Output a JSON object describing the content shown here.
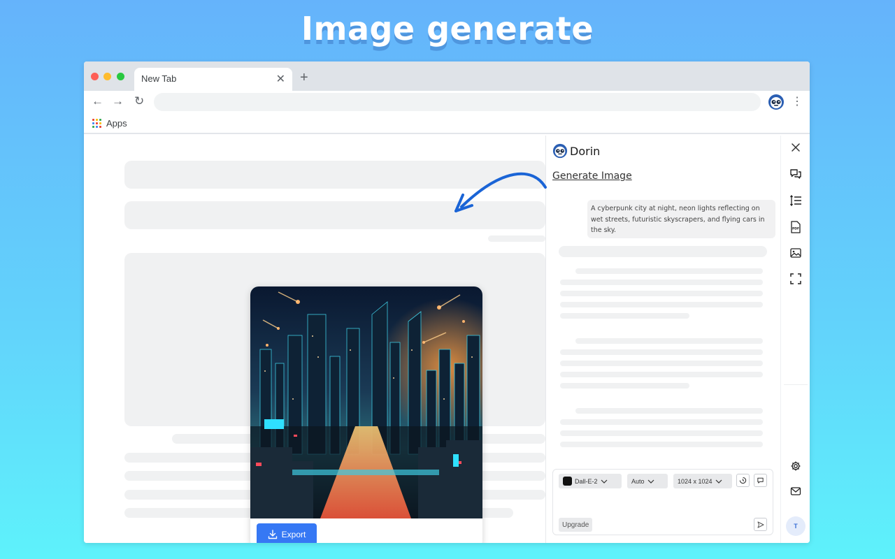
{
  "hero": {
    "title": "Image generate"
  },
  "browser": {
    "tab_title": "New Tab",
    "tab_close": "✕",
    "new_tab": "+",
    "back": "←",
    "forward": "→",
    "reload": "↻",
    "menu": "⋮",
    "bookmark_apps": "Apps",
    "apps_colors": [
      "#ea4335",
      "#fbbc05",
      "#34a853",
      "#4285f4",
      "#ea4335",
      "#fbbc05",
      "#34a853",
      "#4285f4",
      "#ea4335"
    ]
  },
  "image_card": {
    "export_label": "Export",
    "icons": {
      "export": "download-icon"
    }
  },
  "panel": {
    "brand_name": "Dorin",
    "heading": "Generate Image",
    "prompt_text": "A cyberpunk city at night, neon lights reflecting on wet streets, futuristic skyscrapers, and flying cars in the sky.",
    "compose": {
      "model": "Dall-E-2",
      "quality": "Auto",
      "size": "1024 x 1024",
      "upgrade_label": "Upgrade"
    }
  },
  "rail": {
    "icons": [
      "close-icon",
      "chat-icon",
      "line-spacing-icon",
      "pdf-icon",
      "image-icon",
      "screenshot-icon",
      "settings-icon",
      "mail-icon"
    ],
    "pdf_text": "PDF",
    "avatar_letter": "T"
  },
  "colors": {
    "background_top": "#65b3fb",
    "background_bottom": "#5ef2fb",
    "accent_blue": "#3678f4",
    "arrow_blue": "#1a64d6"
  }
}
